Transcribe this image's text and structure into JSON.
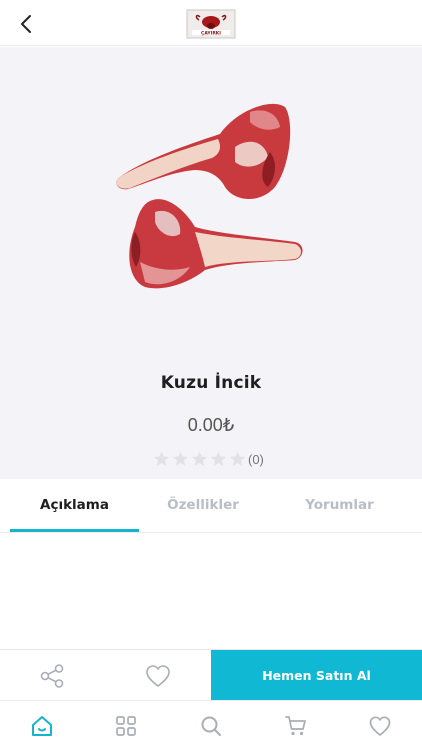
{
  "header": {
    "back_icon": "chevron-left-icon",
    "logo_text": "ÇAYIRKI"
  },
  "product": {
    "title": "Kuzu İncik",
    "price": "0.00₺",
    "rating_value": 0,
    "rating_max": 5,
    "rating_count": "(0)",
    "image": "lamb-shank-meat-photo"
  },
  "tabs": [
    {
      "label": "Açıklama",
      "active": true
    },
    {
      "label": "Özellikler",
      "active": false
    },
    {
      "label": "Yorumlar",
      "active": false
    }
  ],
  "actions": {
    "share_icon": "share-icon",
    "favorite_icon": "heart-icon",
    "buy_label": "Hemen Satın Al"
  },
  "bottom_nav": [
    {
      "icon": "home-icon",
      "active": true
    },
    {
      "icon": "grid-icon",
      "active": false
    },
    {
      "icon": "search-icon",
      "active": false
    },
    {
      "icon": "cart-icon",
      "active": false
    },
    {
      "icon": "heart-icon",
      "active": false
    }
  ],
  "colors": {
    "accent": "#11b8d4",
    "inactive_text": "#b8bdc6",
    "star_empty": "#e2e2e6"
  }
}
